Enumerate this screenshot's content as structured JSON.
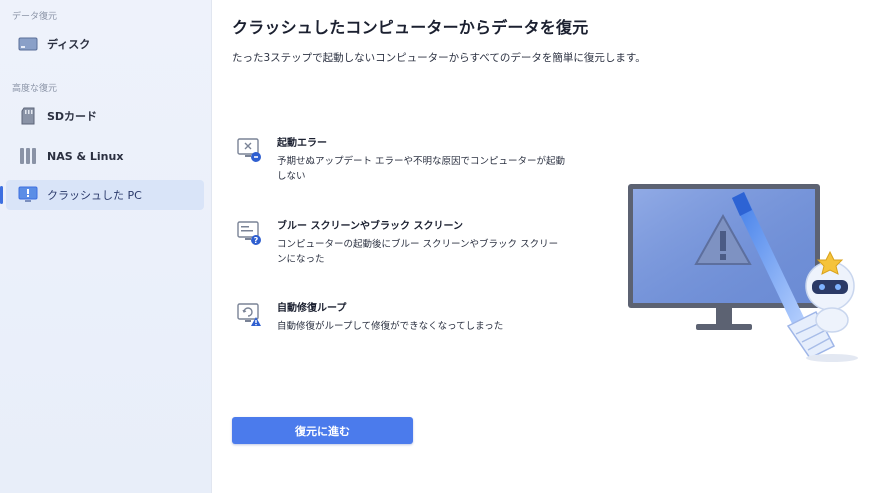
{
  "sidebar": {
    "section_data_recovery": "データ復元",
    "section_advanced": "高度な復元",
    "items": [
      {
        "label": "ディスク",
        "icon": "disk-icon"
      },
      {
        "label": "SDカード",
        "icon": "sd-card-icon"
      },
      {
        "label": "NAS & Linux",
        "icon": "nas-icon"
      },
      {
        "label": "クラッシュした PC",
        "icon": "crashed-pc-icon",
        "active": true
      }
    ]
  },
  "main": {
    "title": "クラッシュしたコンピューターからデータを復元",
    "subtitle": "たった3ステップで起動しないコンピューターからすべてのデータを簡単に復元します。",
    "features": [
      {
        "name": "起動エラー",
        "description": "予期せぬアップデート エラーや不明な原因でコンピューターが起動しない",
        "icon": "boot-error-icon"
      },
      {
        "name": "ブルー スクリーンやブラック スクリーン",
        "description": "コンピューターの起動後にブルー スクリーンやブラック スクリーンになった",
        "icon": "blue-screen-icon"
      },
      {
        "name": "自動修復ループ",
        "description": "自動修復がループして修復ができなくなってしまった",
        "icon": "repair-loop-icon"
      }
    ],
    "recover_button": "復元に進む"
  },
  "colors": {
    "accent": "#4b7bec",
    "sidebar_bg": "#eef2fb",
    "active_bg": "#d9e4f8"
  }
}
